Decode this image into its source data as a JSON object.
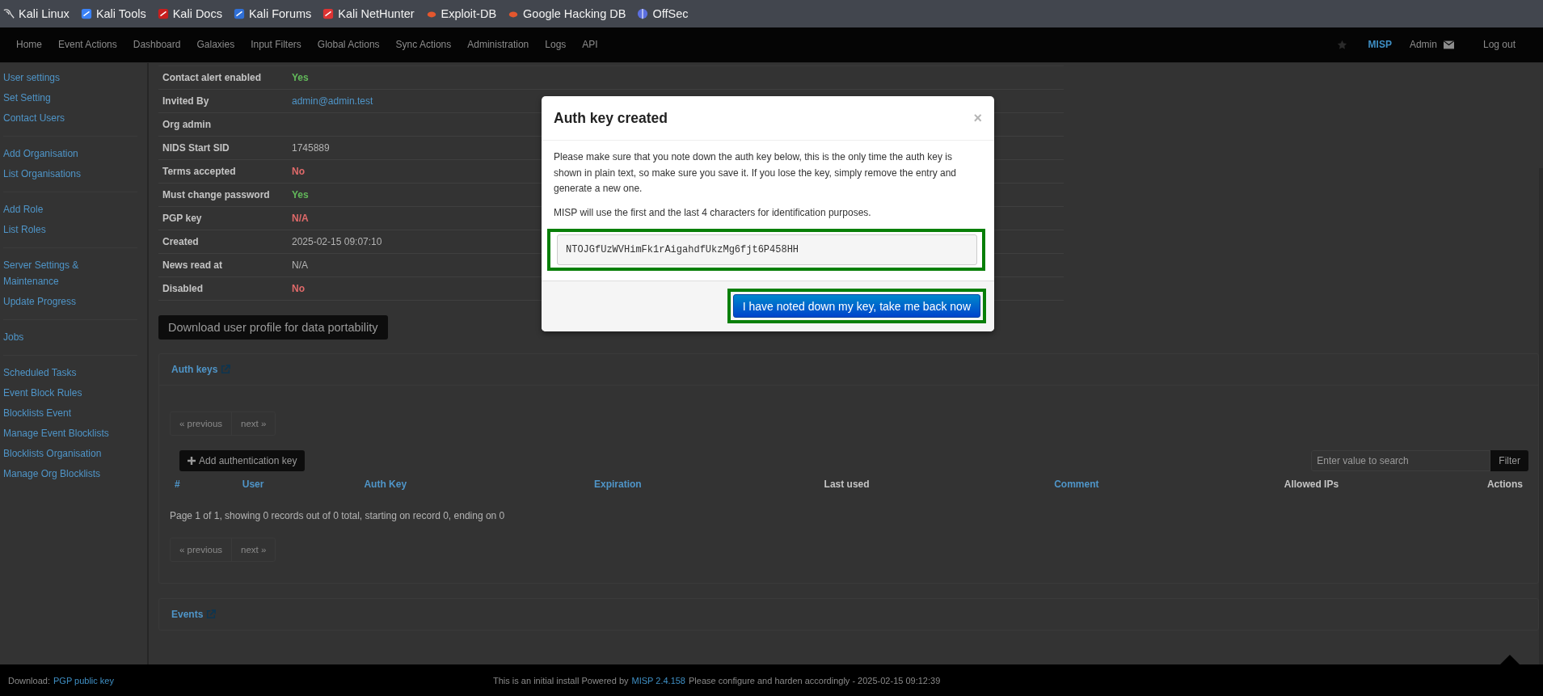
{
  "bookmarks": [
    {
      "label": "Kali Linux"
    },
    {
      "label": "Kali Tools"
    },
    {
      "label": "Kali Docs"
    },
    {
      "label": "Kali Forums"
    },
    {
      "label": "Kali NetHunter"
    },
    {
      "label": "Exploit-DB"
    },
    {
      "label": "Google Hacking DB"
    },
    {
      "label": "OffSec"
    }
  ],
  "nav": {
    "items": [
      "Home",
      "Event Actions",
      "Dashboard",
      "Galaxies",
      "Input Filters",
      "Global Actions",
      "Sync Actions",
      "Administration",
      "Logs",
      "API"
    ],
    "brand": "MISP",
    "user": "Admin",
    "logout": "Log out"
  },
  "sidebar": {
    "groups": [
      [
        "User settings",
        "Set Setting",
        "Contact Users"
      ],
      [
        "Add Organisation",
        "List Organisations"
      ],
      [
        "Add Role",
        "List Roles"
      ],
      [
        "Server Settings & Maintenance",
        "Update Progress"
      ],
      [
        "Jobs"
      ],
      [
        "Scheduled Tasks",
        "Event Block Rules",
        "Blocklists Event",
        "Manage Event Blocklists",
        "Blocklists Organisation",
        "Manage Org Blocklists"
      ]
    ]
  },
  "details": {
    "rows": [
      {
        "label": "Contact alert enabled",
        "value": "Yes",
        "kind": "positive"
      },
      {
        "label": "Invited By",
        "value": "admin@admin.test",
        "kind": "link"
      },
      {
        "label": "Org admin",
        "value": "",
        "kind": "text"
      },
      {
        "label": "NIDS Start SID",
        "value": "1745889",
        "kind": "text"
      },
      {
        "label": "Terms accepted",
        "value": "No",
        "kind": "negative"
      },
      {
        "label": "Must change password",
        "value": "Yes",
        "kind": "positive"
      },
      {
        "label": "PGP key",
        "value": "N/A",
        "kind": "negative"
      },
      {
        "label": "Created",
        "value": "2025-02-15 09:07:10",
        "kind": "text"
      },
      {
        "label": "News read at",
        "value": "N/A",
        "kind": "text"
      },
      {
        "label": "Disabled",
        "value": "No",
        "kind": "negative"
      }
    ]
  },
  "download_button": "Download user profile for data portability",
  "auth_keys": {
    "title": "Auth keys",
    "pagination_top": [
      {
        "label": "« previous",
        "disabled": true
      },
      {
        "label": "next »",
        "disabled": true
      }
    ],
    "add_button": "Add authentication key",
    "search": {
      "placeholder": "Enter value to search"
    },
    "filter_button": "Filter",
    "columns": [
      {
        "label": "#",
        "sortable": true
      },
      {
        "label": "User",
        "sortable": true
      },
      {
        "label": "Auth Key",
        "sortable": true
      },
      {
        "label": "Expiration",
        "sortable": true
      },
      {
        "label": "Last used",
        "sortable": false
      },
      {
        "label": "Comment",
        "sortable": true
      },
      {
        "label": "Allowed IPs",
        "sortable": false
      },
      {
        "label": "Actions",
        "sortable": false
      }
    ],
    "summary": "Page 1 of 1, showing 0 records out of 0 total, starting on record 0, ending on 0",
    "pagination_bottom": [
      {
        "label": "« previous",
        "disabled": true
      },
      {
        "label": "next »",
        "disabled": true
      }
    ]
  },
  "events": {
    "title": "Events"
  },
  "footer": {
    "download_label": "Download:",
    "download_link": "PGP public key",
    "text_before": "This is an initial install Powered by",
    "version_link": "MISP 2.4.158",
    "text_after": "Please configure and harden accordingly - 2025-02-15 09:12:39"
  },
  "modal": {
    "title": "Auth key created",
    "close": "×",
    "paragraphs": [
      "Please make sure that you note down the auth key below, this is the only time the auth key is shown in plain text, so make sure you save it. If you lose the key, simply remove the entry and generate a new one.",
      "MISP will use the first and the last 4 characters for identification purposes."
    ],
    "key": "NTOJGfUzWVHimFk1rAigahdfUkzMg6fjt6P458HH",
    "button": "I have noted down my key, take me back now"
  }
}
